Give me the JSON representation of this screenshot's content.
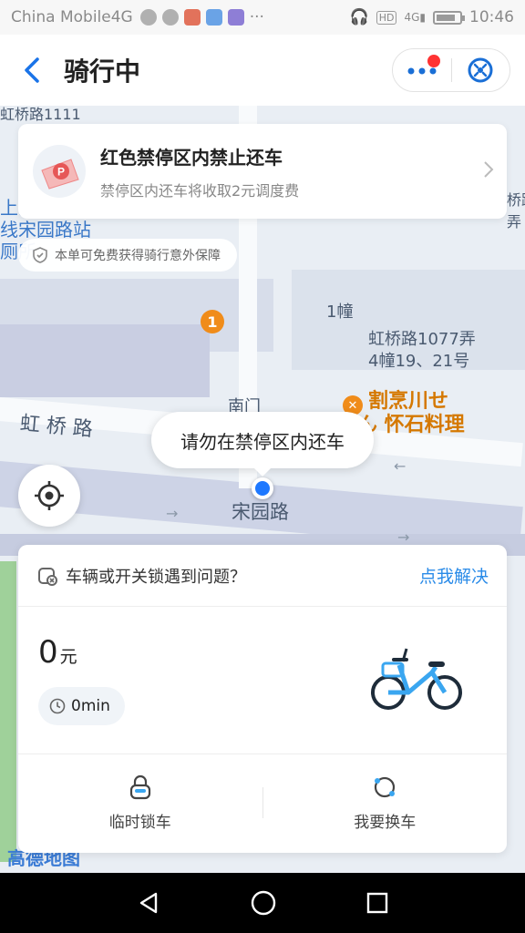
{
  "status_bar": {
    "carrier": "China Mobile4G",
    "time": "10:46",
    "icons": [
      "spotify-icon",
      "chat-icon",
      "app-icon",
      "app-icon",
      "music-icon",
      "more-icon",
      "headphone-icon",
      "hd-icon",
      "signal-icon",
      "battery-icon"
    ]
  },
  "header": {
    "title": "骑行中",
    "back_icon": "back-chevron-icon",
    "more_icon": "more-dots-icon",
    "close_icon": "close-circle-icon"
  },
  "map": {
    "labels": {
      "top_road": "虹桥路1111",
      "left_station_1": "上海",
      "left_station_2": "线宋园路站",
      "left_station_3": "厕所",
      "building_1": "1幢",
      "address_1": "虹桥路1077弄",
      "address_2": "4幢19、21号",
      "restaurant_1": "割烹川せ",
      "restaurant_2": "ん 怀石料理",
      "road_main": "虹 桥 路",
      "road_song": "宋园路",
      "south_gate": "南门",
      "right_cut_1": "桥路",
      "right_cut_2": "弄"
    },
    "poi_badge": "1",
    "amap_logo": "高德地图"
  },
  "parking_notice": {
    "title": "红色禁停区内禁止还车",
    "subtitle": "禁停区内还车将收取2元调度费"
  },
  "insurance": {
    "text": "本单可免费获得骑行意外保障"
  },
  "bubble": {
    "text": "请勿在禁停区内还车"
  },
  "panel": {
    "problem_text": "车辆或开关锁遇到问题？",
    "fix_link": "点我解决",
    "fare_value": "0",
    "fare_unit": "元",
    "time_value": "0min",
    "actions": [
      {
        "label": "临时锁车",
        "icon": "lock-icon"
      },
      {
        "label": "我要换车",
        "icon": "swap-bike-icon"
      }
    ]
  },
  "colors": {
    "accent_blue": "#2a8be8",
    "header_back": "#1a73e8",
    "location_blue": "#1e78ff",
    "poi_orange": "#f08c1a",
    "red_dot": "#ff3333"
  }
}
